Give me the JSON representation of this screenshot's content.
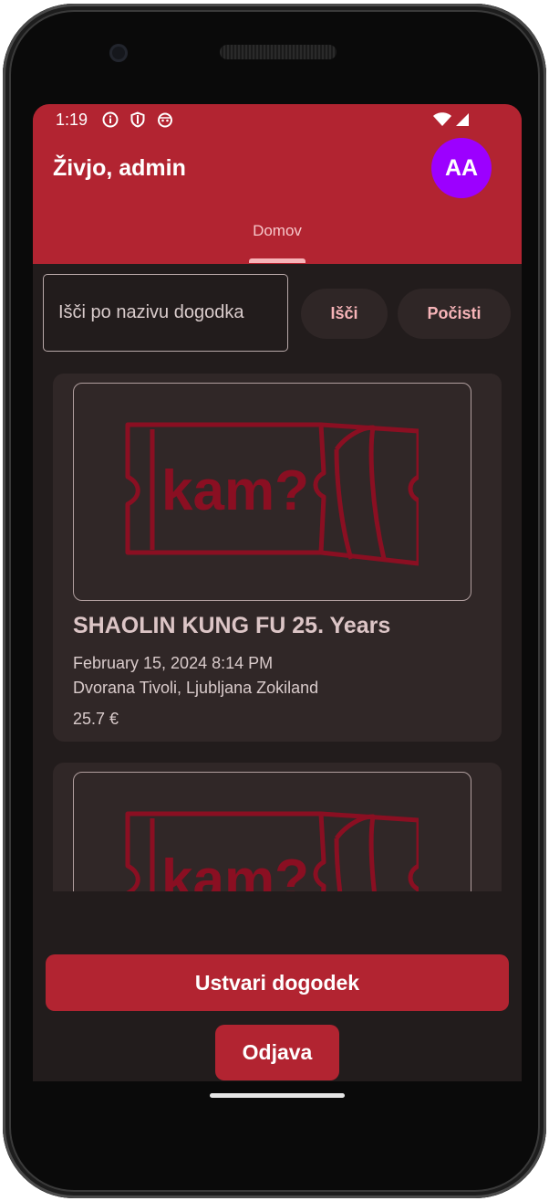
{
  "status_bar": {
    "time": "1:19",
    "icons": [
      "info-icon",
      "shield-icon",
      "android-face-icon",
      "wifi-icon",
      "signal-icon"
    ]
  },
  "app_bar": {
    "greeting": "Živjo, admin",
    "avatar_initials": "AA"
  },
  "tabs": [
    {
      "label": "Domov",
      "selected": true
    }
  ],
  "search": {
    "placeholder": "Išči po nazivu dogodka",
    "value": "",
    "search_button": "Išči",
    "clear_button": "Počisti"
  },
  "events": [
    {
      "image_logo_text": "kam?",
      "title": "SHAOLIN KUNG FU 25. Years",
      "datetime": "February 15, 2024 8:14 PM",
      "location": "Dvorana Tivoli, Ljubljana Zokiland",
      "price": "25.7 €"
    },
    {
      "image_logo_text": "kam?"
    }
  ],
  "actions": {
    "create_event": "Ustvari dogodek",
    "logout": "Odjava"
  },
  "colors": {
    "primary": "#b22431",
    "background": "#221c1c",
    "card": "#302727",
    "avatar": "#9c00ff",
    "logo": "#8a0f22",
    "accent_text": "#f7b4b8"
  }
}
